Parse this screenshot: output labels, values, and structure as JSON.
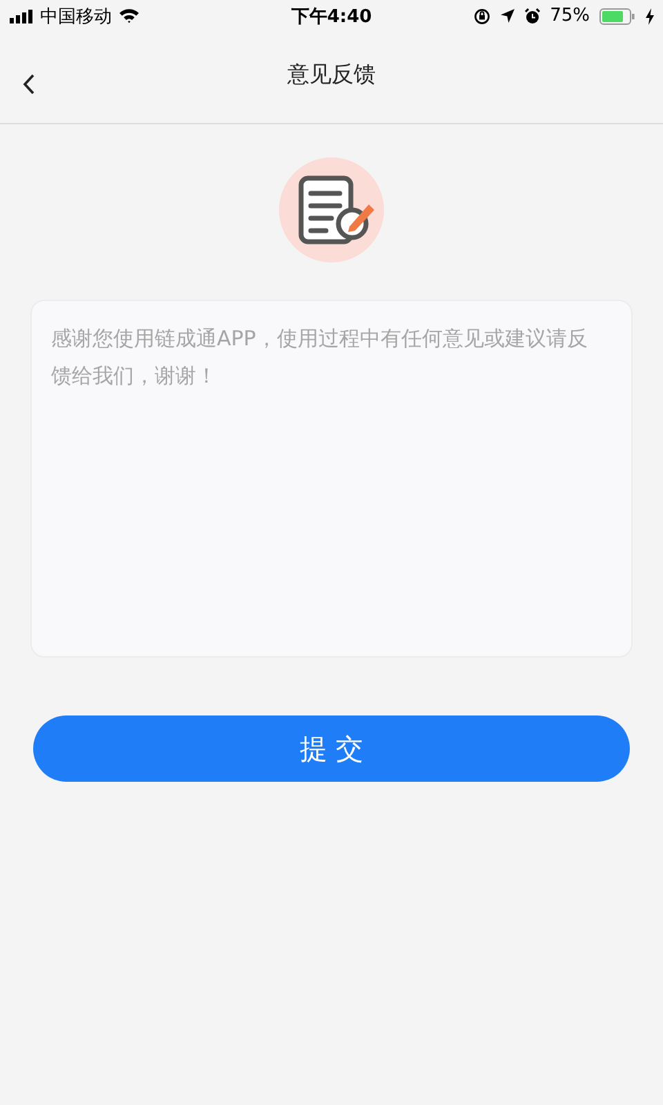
{
  "status_bar": {
    "carrier": "中国移动",
    "time": "下午4:40",
    "battery": "75%"
  },
  "nav": {
    "title": "意见反馈"
  },
  "feedback": {
    "placeholder": "感谢您使用链成通APP，使用过程中有任何意见或建议请反馈给我们，谢谢！"
  },
  "submit": {
    "label": "提 交"
  }
}
